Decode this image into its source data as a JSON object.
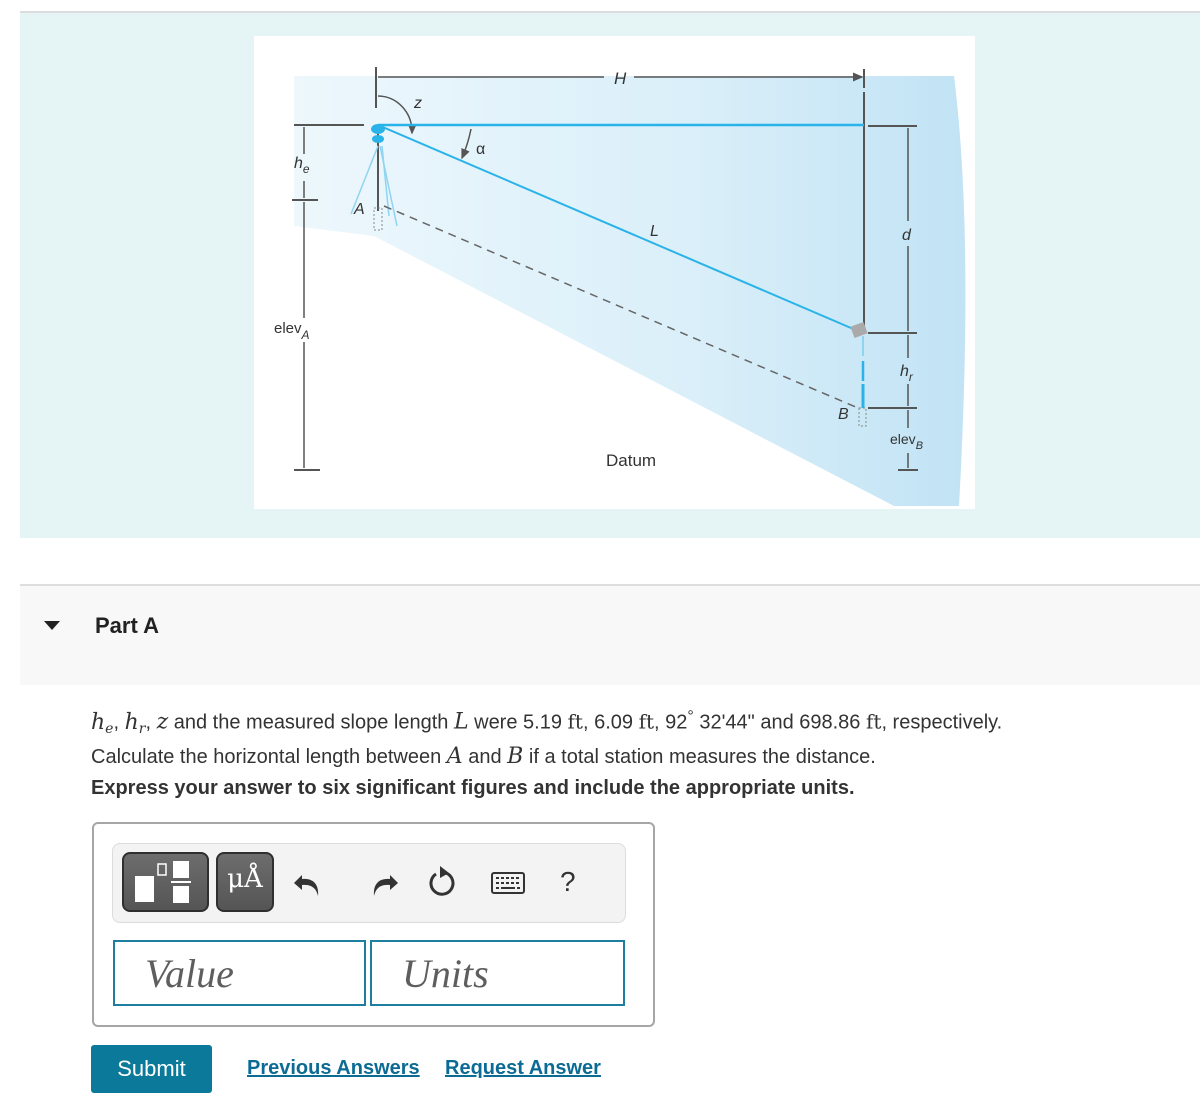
{
  "figure": {
    "description": "Slope distance surveying diagram",
    "labels": {
      "H": "H",
      "z": "z",
      "alpha": "α",
      "L": "L",
      "he": "h",
      "he_sub": "e",
      "hr": "h",
      "hr_sub": "r",
      "d": "d",
      "elevA": "elev",
      "elevA_sub": "A",
      "elevB": "elev",
      "elevB_sub": "B",
      "A": "A",
      "B": "B",
      "datum": "Datum"
    },
    "colors": {
      "sight_line": "#29b3e8",
      "panel_bg": "#e5f5f6",
      "dim_line": "#555555"
    }
  },
  "part": {
    "title": "Part A",
    "expanded": true
  },
  "question": {
    "vars": {
      "he": "h",
      "he_sub": "e",
      "hr": "h",
      "hr_sub": "r",
      "z": "z",
      "L": "L",
      "A": "A",
      "B": "B"
    },
    "text_1": " and the measured slope length ",
    "text_2": " were 5.19 ",
    "unit_ft": "ft",
    "text_3": ", 6.09 ",
    "text_4": ", 92",
    "degree": "°",
    "text_5": " 32'44\" and 698.86 ",
    "text_6": ", respectively.",
    "line2_a": "Calculate the horizontal length between ",
    "line2_b": " and ",
    "line2_c": " if a total station measures the distance.",
    "sep": ", ",
    "instruction": "Express your answer to six significant figures and include the appropriate units."
  },
  "answer": {
    "toolbar": {
      "templates_icon": "fraction-template-icon",
      "units_label": "μÅ",
      "undo_icon": "undo-icon",
      "redo_icon": "redo-icon",
      "reset_icon": "reset-icon",
      "keyboard_icon": "keyboard-icon",
      "help_label": "?"
    },
    "value": {
      "value": "",
      "placeholder": "Value"
    },
    "units": {
      "value": "",
      "placeholder": "Units"
    }
  },
  "actions": {
    "submit_label": "Submit",
    "previous_answers_label": "Previous Answers",
    "request_answer_label": "Request Answer"
  }
}
